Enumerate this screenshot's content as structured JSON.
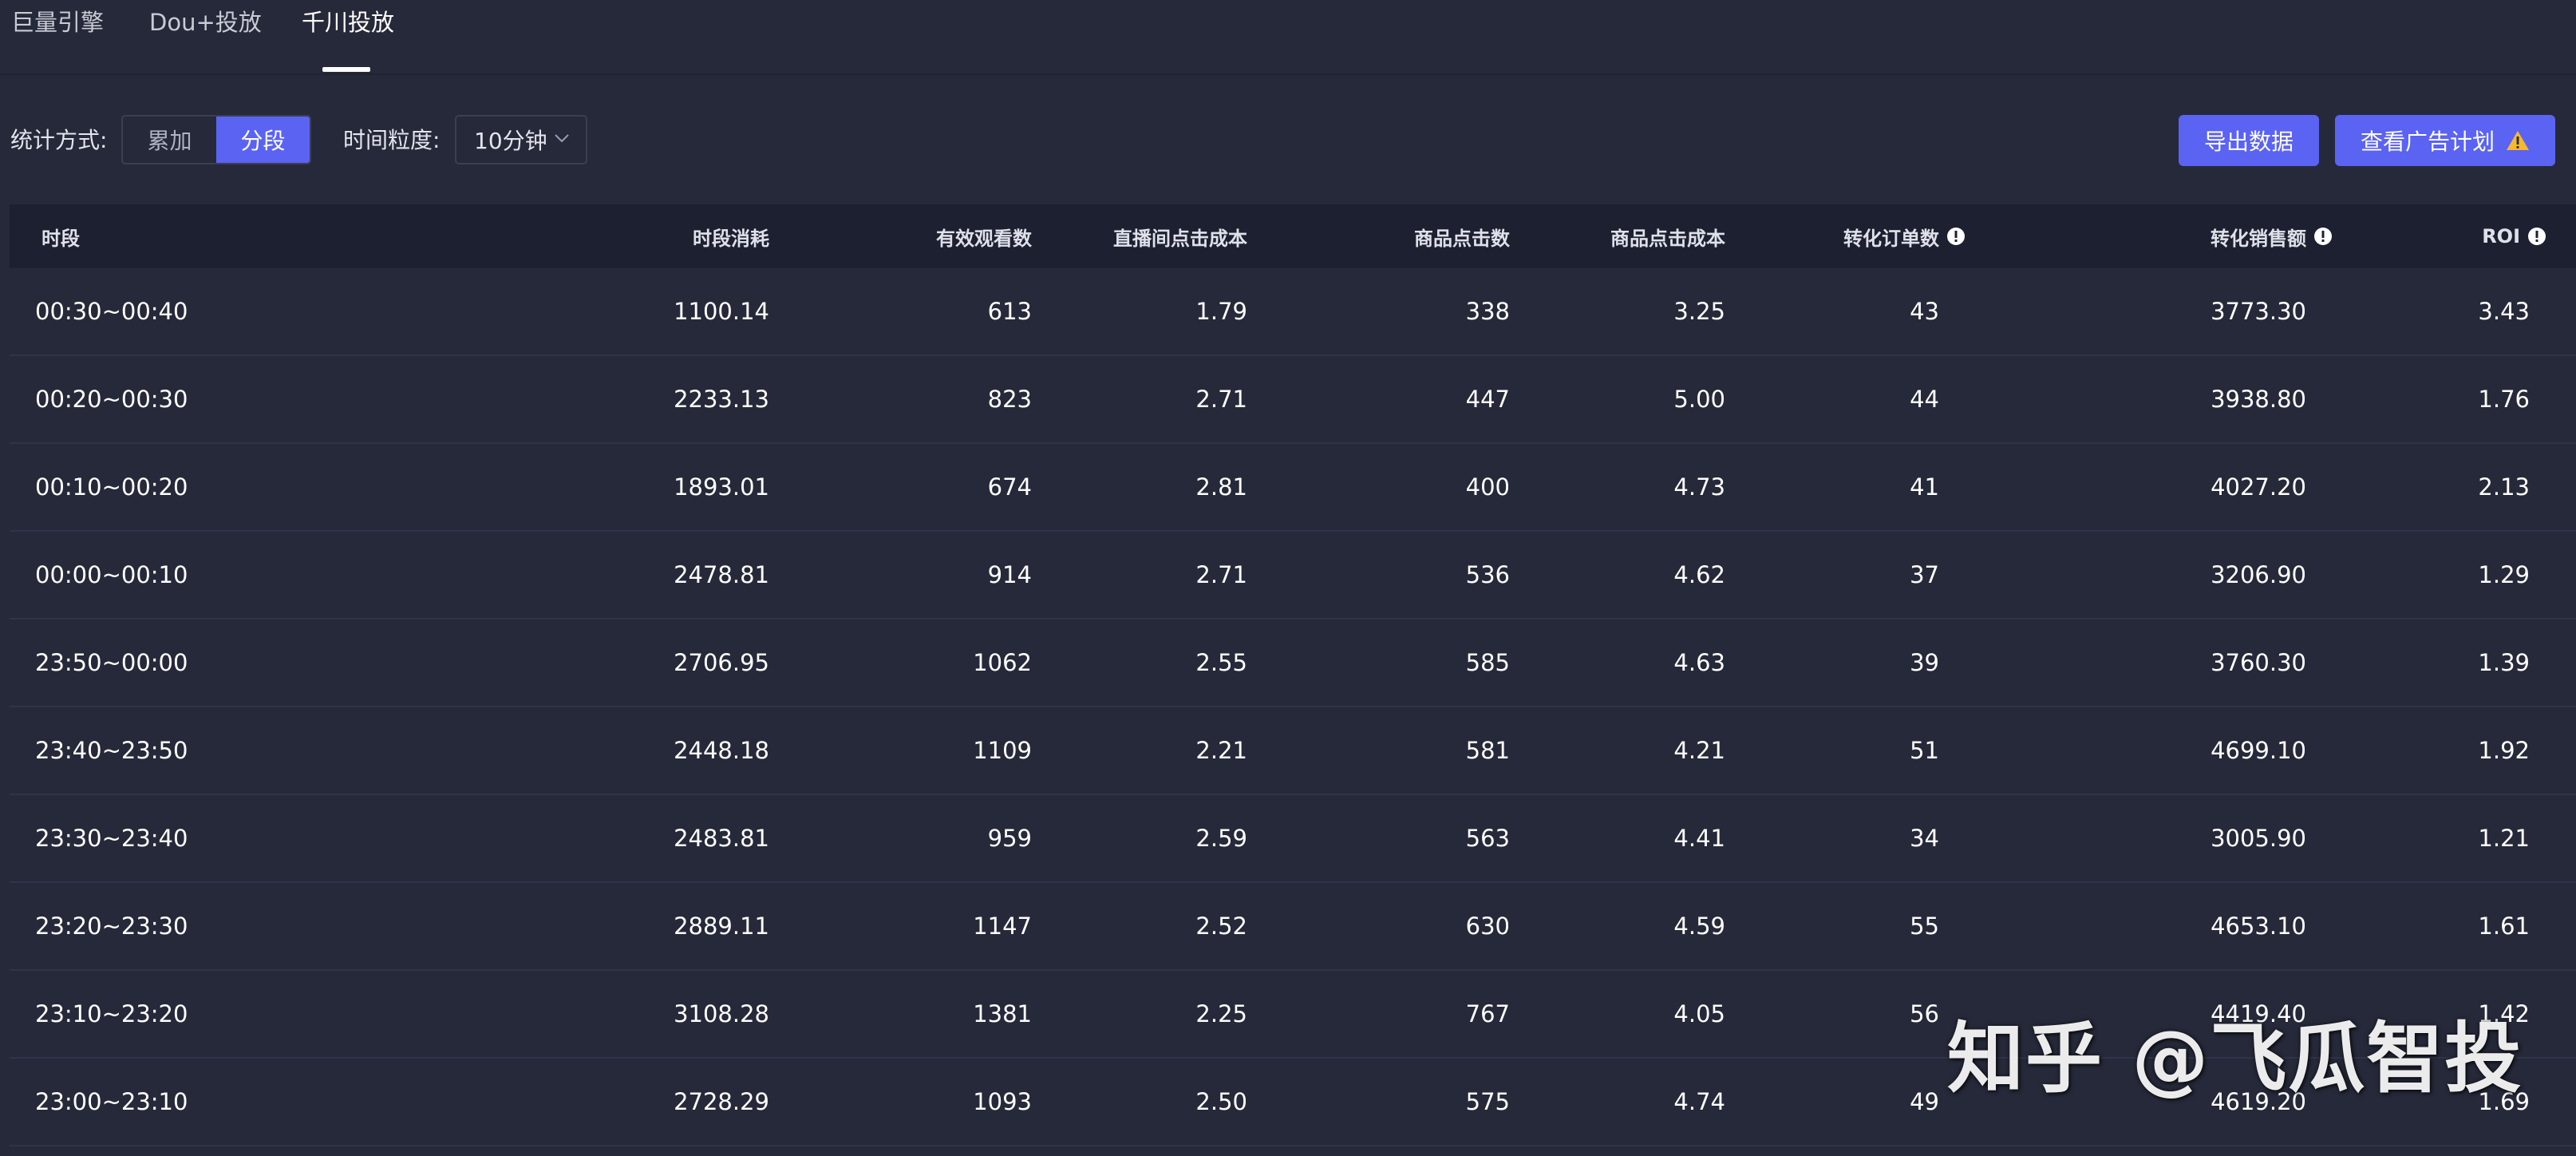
{
  "tabs": [
    {
      "label": "巨量引擎",
      "active": false
    },
    {
      "label": "Dou+投放",
      "active": false
    },
    {
      "label": "千川投放",
      "active": true
    }
  ],
  "toolbar": {
    "stat_mode_label": "统计方式:",
    "stat_modes": [
      {
        "label": "累加",
        "active": false
      },
      {
        "label": "分段",
        "active": true
      }
    ],
    "granularity_label": "时间粒度:",
    "granularity_value": "10分钟",
    "export_button": "导出数据",
    "view_plan_button": "查看广告计划"
  },
  "colors": {
    "background": "#262939",
    "header_bg": "#1d2030",
    "accent": "#5b63f3",
    "warning": "#f5b82e"
  },
  "table": {
    "columns": [
      "时段",
      "时段消耗",
      "有效观看数",
      "直播间点击成本",
      "商品点击数",
      "商品点击成本",
      "转化订单数",
      "转化销售额",
      "ROI"
    ],
    "info_icon_columns": [
      "转化订单数",
      "转化销售额",
      "ROI"
    ],
    "rows": [
      [
        "00:30~00:40",
        "1100.14",
        "613",
        "1.79",
        "338",
        "3.25",
        "43",
        "3773.30",
        "3.43"
      ],
      [
        "00:20~00:30",
        "2233.13",
        "823",
        "2.71",
        "447",
        "5.00",
        "44",
        "3938.80",
        "1.76"
      ],
      [
        "00:10~00:20",
        "1893.01",
        "674",
        "2.81",
        "400",
        "4.73",
        "41",
        "4027.20",
        "2.13"
      ],
      [
        "00:00~00:10",
        "2478.81",
        "914",
        "2.71",
        "536",
        "4.62",
        "37",
        "3206.90",
        "1.29"
      ],
      [
        "23:50~00:00",
        "2706.95",
        "1062",
        "2.55",
        "585",
        "4.63",
        "39",
        "3760.30",
        "1.39"
      ],
      [
        "23:40~23:50",
        "2448.18",
        "1109",
        "2.21",
        "581",
        "4.21",
        "51",
        "4699.10",
        "1.92"
      ],
      [
        "23:30~23:40",
        "2483.81",
        "959",
        "2.59",
        "563",
        "4.41",
        "34",
        "3005.90",
        "1.21"
      ],
      [
        "23:20~23:30",
        "2889.11",
        "1147",
        "2.52",
        "630",
        "4.59",
        "55",
        "4653.10",
        "1.61"
      ],
      [
        "23:10~23:20",
        "3108.28",
        "1381",
        "2.25",
        "767",
        "4.05",
        "56",
        "4419.40",
        "1.42"
      ],
      [
        "23:00~23:10",
        "2728.29",
        "1093",
        "2.50",
        "575",
        "4.74",
        "49",
        "4619.20",
        "1.69"
      ]
    ]
  },
  "watermark": "知乎 @飞瓜智投"
}
